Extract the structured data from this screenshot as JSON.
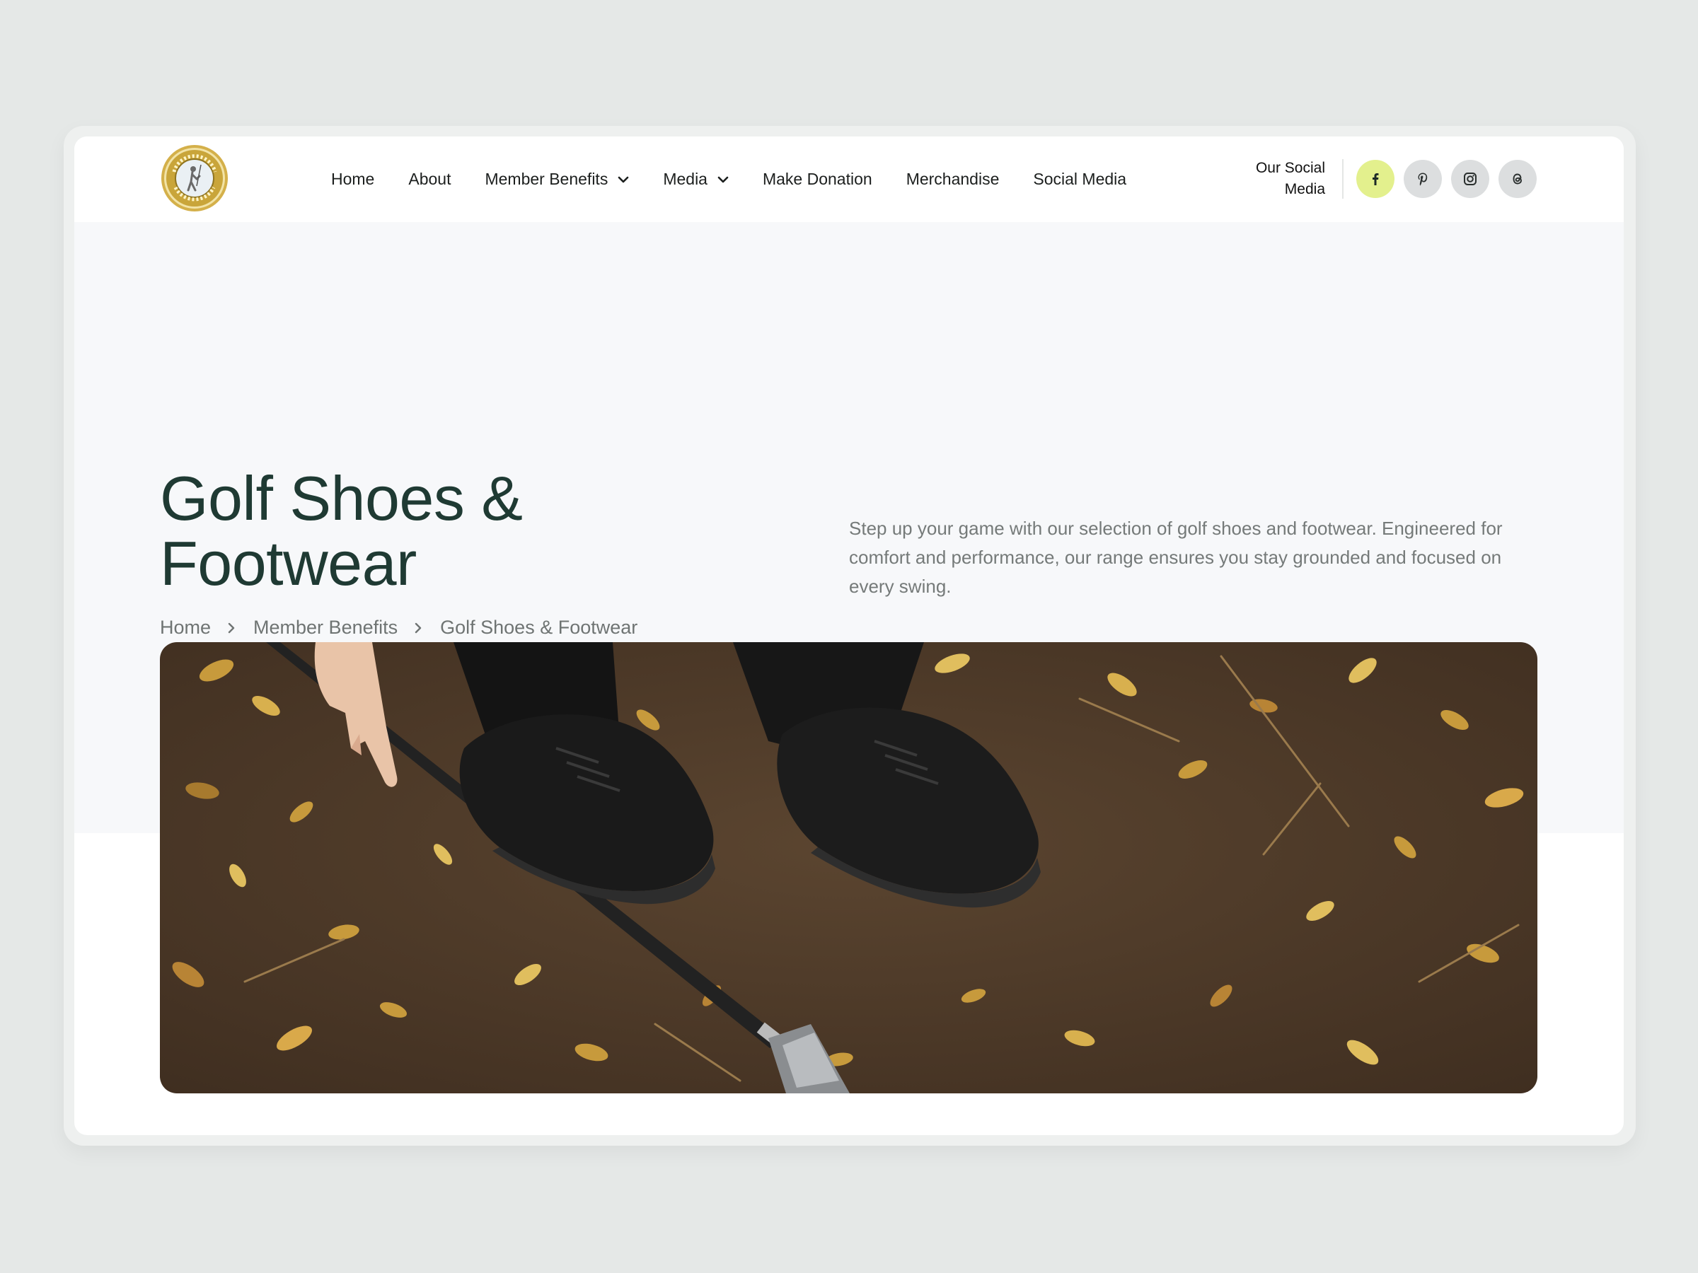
{
  "header": {
    "logo_text": "MINORITY GOLF ASSOCIATION",
    "nav": [
      {
        "label": "Home",
        "dropdown": false
      },
      {
        "label": "About",
        "dropdown": false
      },
      {
        "label": "Member Benefits",
        "dropdown": true
      },
      {
        "label": "Media",
        "dropdown": true
      },
      {
        "label": "Make Donation",
        "dropdown": false
      },
      {
        "label": "Merchandise",
        "dropdown": false
      },
      {
        "label": "Social Media",
        "dropdown": false
      }
    ],
    "social_label_line1": "Our Social",
    "social_label_line2": "Media",
    "social_icons": [
      {
        "icon": "facebook-icon",
        "active": true,
        "color": "#e3f08d"
      },
      {
        "icon": "pinterest-icon",
        "active": false
      },
      {
        "icon": "instagram-icon",
        "active": false
      },
      {
        "icon": "threads-icon",
        "active": false
      }
    ]
  },
  "hero": {
    "title_line1": "Golf Shoes &",
    "title_line2": "Footwear",
    "breadcrumb": [
      "Home",
      "Member Benefits",
      "Golf Shoes & Footwear"
    ],
    "description": "Step up your game with our selection of golf shoes and footwear. Engineered for comfort and performance, our range ensures you stay grounded and focused on every swing.",
    "image_subject": "black golf shoes on leaf-covered dirt with golf club"
  },
  "colors": {
    "page_bg": "#e5e8e7",
    "hero_bg": "#f7f8fa",
    "title": "#1f3a33",
    "accent": "#e3f08d",
    "body_text": "#757a79"
  }
}
